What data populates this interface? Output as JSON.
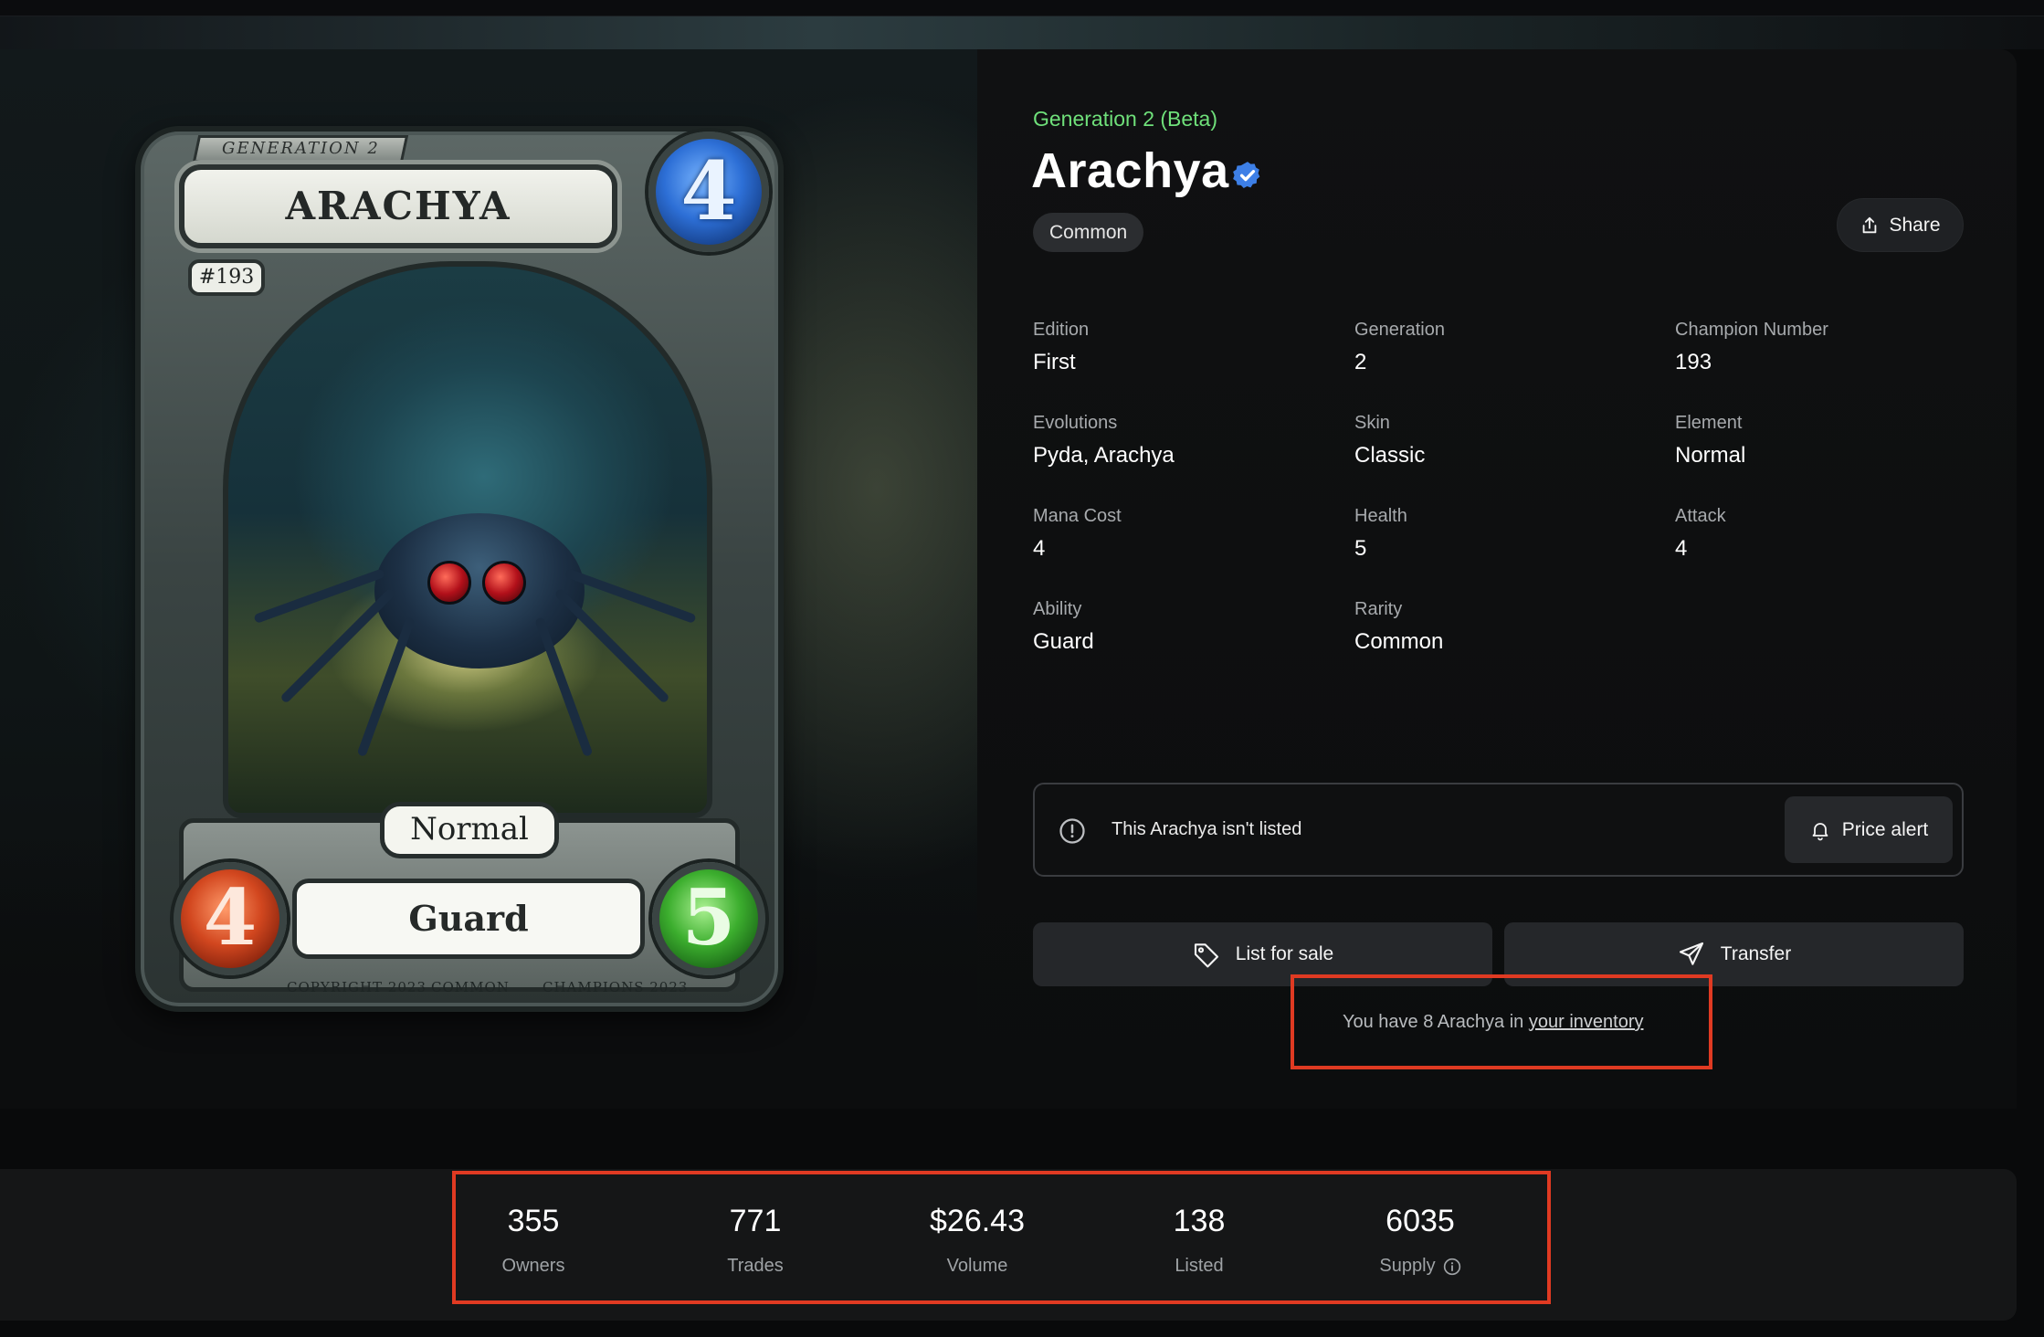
{
  "card": {
    "generation_banner": "GENERATION 2",
    "name": "ARACHYA",
    "mana": "4",
    "number": "#193",
    "type": "Normal",
    "ability": "Guard",
    "attack": "4",
    "health": "5",
    "footer_left": "COPYRIGHT 2023",
    "footer_center": "COMMON",
    "footer_right": "CHAMPIONS 2023"
  },
  "header": {
    "generation": "Generation 2 (Beta)",
    "title": "Arachya",
    "rarity_badge": "Common",
    "share_label": "Share"
  },
  "attributes": [
    {
      "label": "Edition",
      "value": "First"
    },
    {
      "label": "Generation",
      "value": "2"
    },
    {
      "label": "Champion Number",
      "value": "193"
    },
    {
      "label": "Evolutions",
      "value": "Pyda, Arachya"
    },
    {
      "label": "Skin",
      "value": "Classic"
    },
    {
      "label": "Element",
      "value": "Normal"
    },
    {
      "label": "Mana Cost",
      "value": "4"
    },
    {
      "label": "Health",
      "value": "5"
    },
    {
      "label": "Attack",
      "value": "4"
    },
    {
      "label": "Ability",
      "value": "Guard"
    },
    {
      "label": "Rarity",
      "value": "Common"
    }
  ],
  "listing": {
    "message": "This Arachya isn't listed",
    "price_alert_label": "Price alert"
  },
  "actions": {
    "list_label": "List for sale",
    "transfer_label": "Transfer"
  },
  "inventory": {
    "prefix": "You have 8 Arachya in ",
    "link": "your inventory"
  },
  "stats": [
    {
      "value": "355",
      "label": "Owners"
    },
    {
      "value": "771",
      "label": "Trades"
    },
    {
      "value": "$26.43",
      "label": "Volume"
    },
    {
      "value": "138",
      "label": "Listed"
    },
    {
      "value": "6035",
      "label": "Supply"
    }
  ],
  "colors": {
    "generation_green": "#6fe07a",
    "verified_blue": "#3d7fe6",
    "highlight_red": "#e03a22"
  },
  "icons": {
    "verified": "verified-badge-icon",
    "share": "share-icon",
    "info": "info-icon",
    "bell": "bell-icon",
    "tag": "tag-icon",
    "send": "send-icon"
  }
}
